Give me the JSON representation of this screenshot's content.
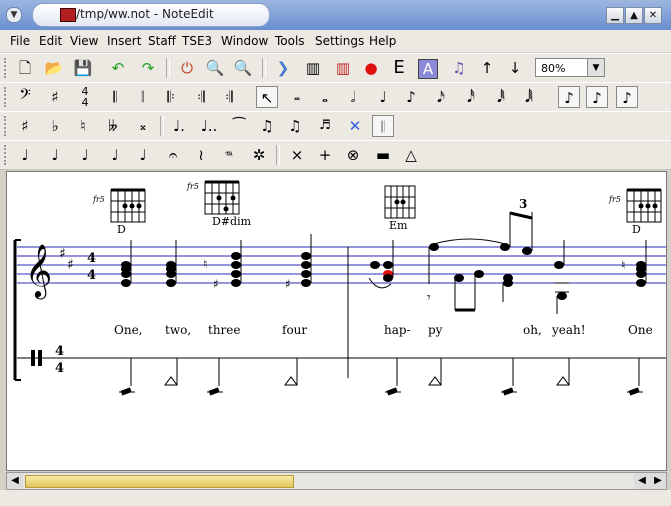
{
  "window": {
    "title": "/tmp/ww.not - NoteEdit",
    "buttons": {
      "minimize": "▁",
      "maximize": "▲",
      "close": "✕"
    }
  },
  "menu": [
    "File",
    "Edit",
    "View",
    "Insert",
    "Staff",
    "TSE3",
    "Window",
    "Tools",
    "Settings",
    "Help"
  ],
  "toolbar": {
    "zoom_value": "80%"
  },
  "score": {
    "chords": [
      "D",
      "D#dim",
      "Em",
      "D"
    ],
    "fret_labels": [
      "fr5",
      "fr5",
      "fr5"
    ],
    "lyrics": [
      "One,",
      "two,",
      "three",
      "four",
      "hap-",
      "py",
      "oh,",
      "yeah!",
      "One"
    ],
    "tuplet": "3",
    "time_signature_top": "4",
    "time_signature_bottom": "4",
    "perc_time_top": "4",
    "perc_time_bottom": "4"
  },
  "colors": {
    "staff_lines": "#2a2ab8",
    "highlight_note": "#e01010",
    "title_gradient_top": "#9cb6e0",
    "scroll_thumb": "#e2c65a"
  }
}
